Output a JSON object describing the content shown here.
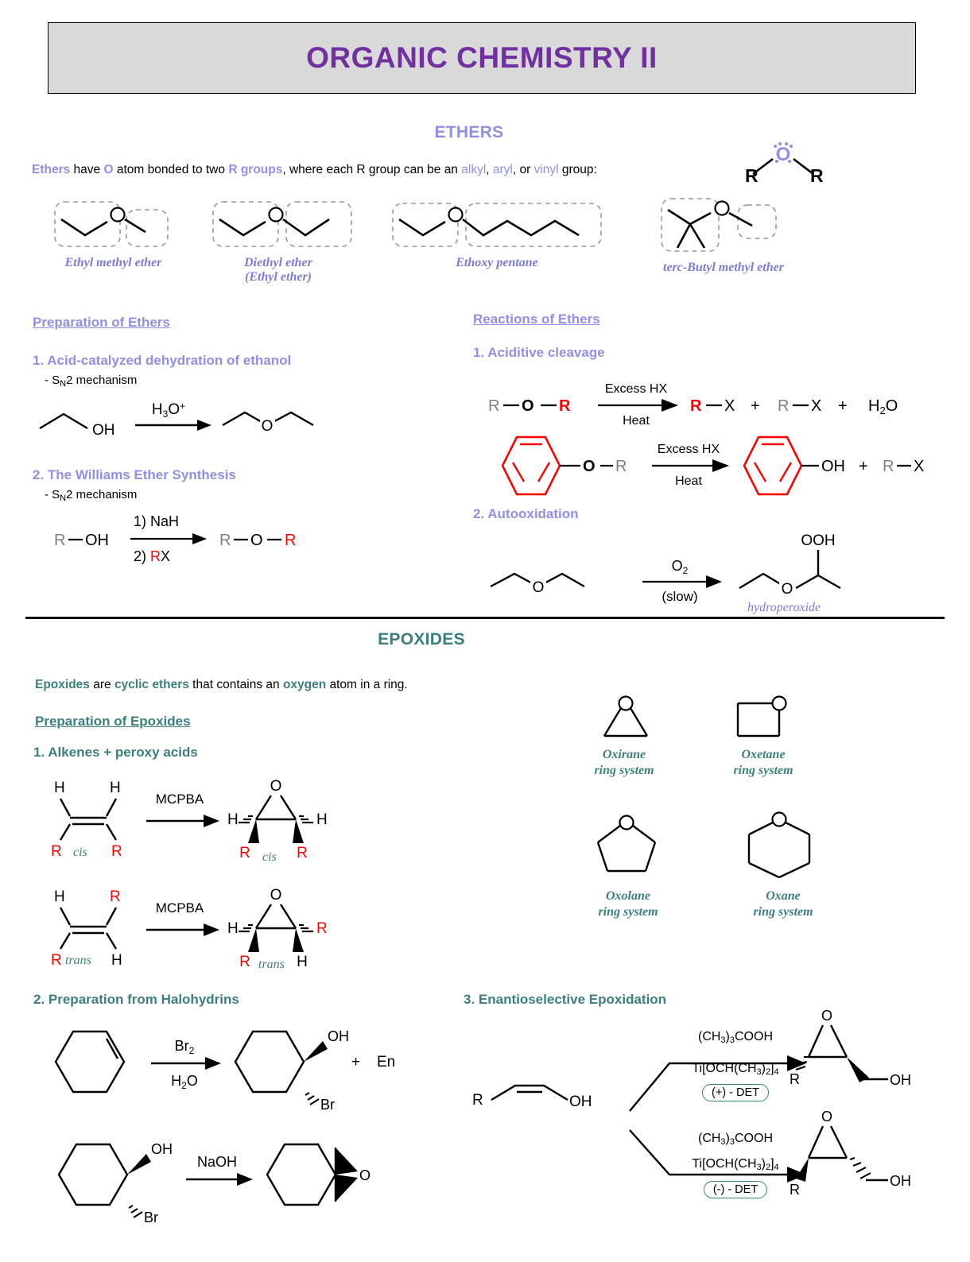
{
  "title": "ORGANIC CHEMISTRY II",
  "ethers": {
    "heading": "ETHERS",
    "intro": {
      "w1": "Ethers",
      "w2": " have ",
      "w3": "O",
      "w4": " atom bonded to two ",
      "w5": "R groups",
      "w6": ", where each R group can be an ",
      "w7": "alkyl",
      "w8": ", ",
      "w9": "aryl",
      "w10": ", or ",
      "w11": "vinyl",
      "w12": " group:"
    },
    "general_structure": {
      "left_r": "R",
      "oxygen": "O",
      "right_r": "R"
    },
    "examples": [
      {
        "name": "Ethyl methyl ether",
        "name2": ""
      },
      {
        "name": "Diethyl ether",
        "name2": "(Ethyl ether)"
      },
      {
        "name": "Ethoxy pentane",
        "name2": ""
      },
      {
        "name": "terc-Butyl methyl ether",
        "name2": ""
      }
    ],
    "preparation": {
      "heading": "Preparation of Ethers",
      "item1": {
        "title": "1. Acid-catalyzed dehydration of ethanol",
        "sub": "- SN2 mechanism",
        "reagent": "H3O+",
        "reactant_label": "OH"
      },
      "item2": {
        "title": "2. The Williams Ether Synthesis",
        "sub": "- SN2 mechanism",
        "reactant": "R—OH",
        "reagent1": "1) NaH",
        "reagent2a": "2) ",
        "reagent2b": "R",
        "reagent2c": "X",
        "product_r1": "R",
        "product_o": "O",
        "product_r2": "R"
      }
    },
    "reactions": {
      "heading": "Reactions of Ethers",
      "item1": {
        "title": "1. Aciditive cleavage",
        "rxn1": {
          "reactant_r1": "R",
          "reactant_o": "O",
          "reactant_r2": "R",
          "above": "Excess HX",
          "below": "Heat",
          "p1r": "R",
          "p1x": "X",
          "plus1": "+",
          "p2r": "R",
          "p2x": "X",
          "plus2": "+",
          "water": "H2O"
        },
        "rxn2": {
          "o_label": "O",
          "r_label": "R",
          "above": "Excess HX",
          "below": "Heat",
          "product_oh": "OH",
          "plus": "+",
          "p_r": "R",
          "p_x": "X"
        }
      },
      "item2": {
        "title": "2. Autooxidation",
        "above": "O2",
        "below": "(slow)",
        "product_group": "OOH",
        "product_name": "hydroperoxide"
      }
    }
  },
  "epoxides": {
    "heading": "EPOXIDES",
    "intro": {
      "w1": "Epoxides",
      "w2": " are ",
      "w3": "cyclic ethers",
      "w4": " that contains an ",
      "w5": "oxygen",
      "w6": " atom in a ring."
    },
    "preparation_heading": "Preparation of Epoxides",
    "item1": {
      "title": "1. Alkenes + peroxy acids",
      "rxn_cis": {
        "reagent": "MCPBA",
        "h_tl": "H",
        "h_tr": "H",
        "r_bl": "R",
        "r_br": "R",
        "label_left": "cis",
        "o": "O",
        "p_h_left": "H",
        "p_h_right": "H",
        "p_r_left": "R",
        "p_r_right": "R",
        "label_right": "cis"
      },
      "rxn_trans": {
        "reagent": "MCPBA",
        "h_tl": "H",
        "r_tr": "R",
        "r_bl": "R",
        "h_br": "H",
        "label_left": "trans",
        "o": "O",
        "p_h_left": "H",
        "p_r_right": "R",
        "p_r_left": "R",
        "p_h_right": "H",
        "label_right": "trans"
      }
    },
    "item2": {
      "title": "2. Preparation from Halohydrins",
      "rxn1": {
        "above": "Br2",
        "below": "H2O",
        "oh": "OH",
        "br": "Br",
        "plus": "+",
        "en": "En"
      },
      "rxn2": {
        "oh": "OH",
        "br": "Br",
        "reagent": "NaOH",
        "product_o": "O"
      }
    },
    "item3": {
      "title": "3. Enantioselective Epoxidation",
      "substrate": {
        "r": "R",
        "oh": "OH"
      },
      "rxn_top": {
        "reagent1": "(CH3)3COOH",
        "reagent2": "Ti[OCH(CH3)2]4",
        "det": "(+) - DET",
        "o": "O",
        "r": "R",
        "oh": "OH"
      },
      "rxn_bottom": {
        "reagent1": "(CH3)3COOH",
        "reagent2": "Ti[OCH(CH3)2]4",
        "det": "(-) - DET",
        "o": "O",
        "r": "R",
        "oh": "OH"
      }
    },
    "ring_systems": [
      {
        "name": "Oxirane",
        "sub": "ring system",
        "o": "O"
      },
      {
        "name": "Oxetane",
        "sub": "ring system",
        "o": "O"
      },
      {
        "name": "Oxolane",
        "sub": "ring system",
        "o": "O"
      },
      {
        "name": "Oxane",
        "sub": "ring system",
        "o": "O"
      }
    ]
  },
  "colors": {
    "title_purple": "#7030a0",
    "ether_periwinkle": "#8f8fe8",
    "epoxide_teal": "#3b7f7c",
    "red": "#ff0000",
    "grey": "#808080",
    "banner_bg": "#d9d9d9"
  }
}
